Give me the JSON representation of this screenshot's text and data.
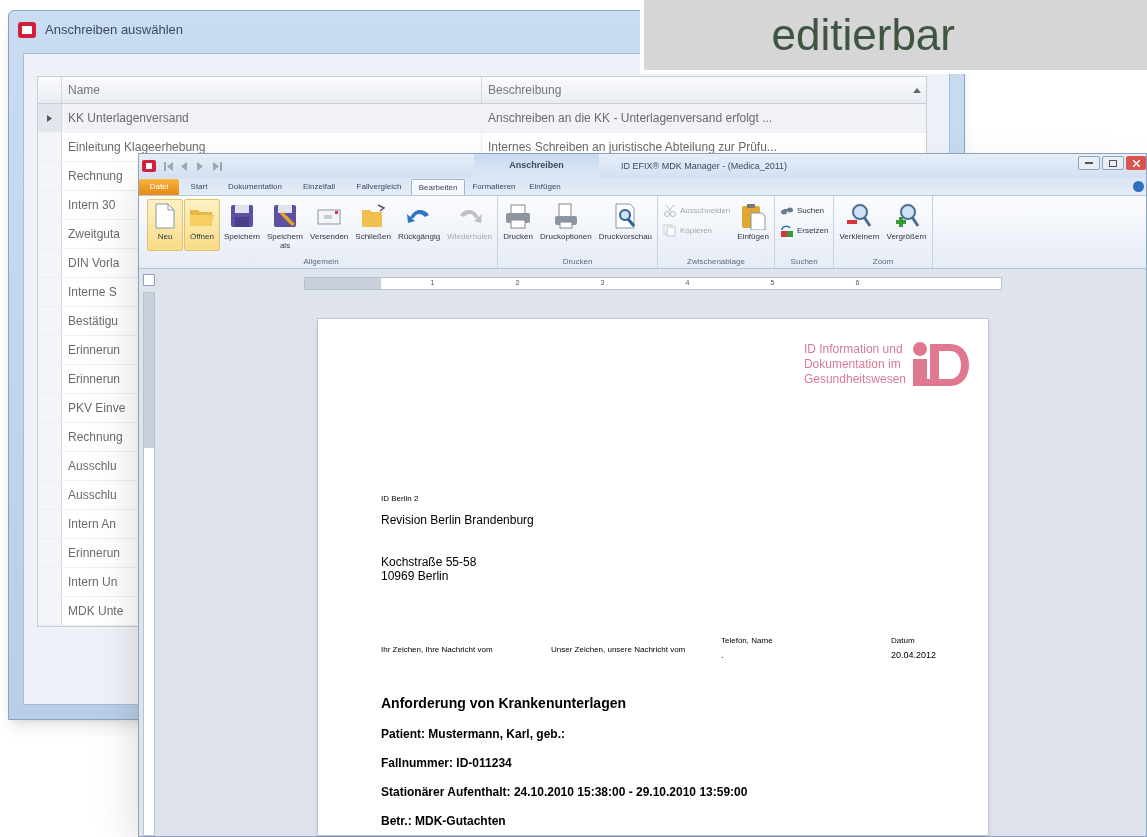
{
  "banner": {
    "text": "editierbar"
  },
  "dialog": {
    "title": "Anschreiben auswählen",
    "columns": [
      "Name",
      "Beschreibung"
    ],
    "rows": [
      {
        "name": "KK Unterlagenversand",
        "description": "Anschreiben an die KK - Unterlagenversand erfolgt ...",
        "selected": true
      },
      {
        "name": "Einleitung Klageerhebung",
        "description": "Internes Schreiben an juristische Abteilung zur Prüfu...",
        "selected": false
      },
      {
        "name": "Rechnung",
        "selected": false
      },
      {
        "name": "Intern 30",
        "selected": false
      },
      {
        "name": "Zweitguta",
        "selected": false
      },
      {
        "name": "DIN Vorla",
        "selected": false
      },
      {
        "name": "Interne S",
        "selected": false
      },
      {
        "name": "Bestätigu",
        "selected": false
      },
      {
        "name": "Erinnerun",
        "selected": false
      },
      {
        "name": "Erinnerun",
        "selected": false
      },
      {
        "name": "PKV Einve",
        "selected": false
      },
      {
        "name": "Rechnung",
        "selected": false
      },
      {
        "name": "Ausschlu",
        "selected": false
      },
      {
        "name": "Ausschlu",
        "selected": false
      },
      {
        "name": "Intern An",
        "selected": false
      },
      {
        "name": "Erinnerun",
        "selected": false
      },
      {
        "name": "Intern Un",
        "selected": false
      },
      {
        "name": "MDK Unte",
        "selected": false
      }
    ]
  },
  "window": {
    "context_tab": "Anschreiben",
    "title": "ID EFIX® MDK Manager - (Medica_2011)",
    "tabs": [
      {
        "label": "Datei",
        "kind": "file",
        "selected": false
      },
      {
        "label": "Start",
        "kind": "tab",
        "selected": false
      },
      {
        "label": "Dokumentation",
        "kind": "tab",
        "selected": false
      },
      {
        "label": "Einzelfall",
        "kind": "tab",
        "selected": false
      },
      {
        "label": "Fallvergleich",
        "kind": "tab",
        "selected": false
      },
      {
        "label": "Bearbeiten",
        "kind": "tab",
        "selected": true
      },
      {
        "label": "Formatieren",
        "kind": "tab",
        "selected": false
      },
      {
        "label": "Einfügen",
        "kind": "tab",
        "selected": false
      }
    ],
    "ribbon": [
      {
        "label": "Allgemein",
        "items": [
          {
            "label": "Neu",
            "kind": "large",
            "highlighted": true,
            "disabled": false
          },
          {
            "label": "Öffnen",
            "kind": "large",
            "highlighted": true,
            "disabled": false
          },
          {
            "label": "Speichern",
            "kind": "large",
            "highlighted": false,
            "disabled": false
          },
          {
            "label": "Speichern als",
            "kind": "large",
            "highlighted": false,
            "disabled": false
          },
          {
            "label": "Versenden",
            "kind": "large",
            "highlighted": false,
            "disabled": false
          },
          {
            "label": "Schließen",
            "kind": "large",
            "highlighted": false,
            "disabled": false
          },
          {
            "label": "Rückgängig",
            "kind": "large",
            "highlighted": false,
            "disabled": false
          },
          {
            "label": "Wiederholen",
            "kind": "large",
            "highlighted": false,
            "disabled": true
          }
        ]
      },
      {
        "label": "Drucken",
        "items": [
          {
            "label": "Drucken",
            "kind": "large",
            "highlighted": false,
            "disabled": false
          },
          {
            "label": "Druckoptionen",
            "kind": "large",
            "highlighted": false,
            "disabled": false
          },
          {
            "label": "Druckvorschau",
            "kind": "large",
            "highlighted": false,
            "disabled": false
          }
        ]
      },
      {
        "label": "Zwischenablage",
        "items": [
          {
            "label": "Ausschneiden",
            "kind": "small",
            "highlighted": false,
            "disabled": true
          },
          {
            "label": "Kopieren",
            "kind": "small",
            "highlighted": false,
            "disabled": true
          },
          {
            "label": "Einfügen",
            "kind": "large",
            "highlighted": false,
            "disabled": false
          }
        ]
      },
      {
        "label": "Suchen",
        "items": [
          {
            "label": "Suchen",
            "kind": "small",
            "highlighted": false,
            "disabled": false
          },
          {
            "label": "Ersetzen",
            "kind": "small",
            "highlighted": false,
            "disabled": false
          }
        ]
      },
      {
        "label": "Zoom",
        "items": [
          {
            "label": "Verkleinern",
            "kind": "large",
            "highlighted": false,
            "disabled": false
          },
          {
            "label": "Vergrößern",
            "kind": "large",
            "highlighted": false,
            "disabled": false
          }
        ]
      }
    ],
    "ruler_marks": [
      "1",
      "2",
      "3",
      "4",
      "5",
      "6"
    ]
  },
  "document": {
    "logo_lines": [
      "ID Information und",
      "Dokumentation im",
      "Gesundheitswesen"
    ],
    "sender": "ID Berlin 2",
    "recipient": "Revision Berlin Brandenburg",
    "street": "Kochstraße 55-58",
    "city": "10969 Berlin",
    "reference_fields": [
      {
        "label": "Ihr Zeichen, Ihre Nachricht vom"
      },
      {
        "label": "Unser Zeichen, unsere Nachricht vom"
      },
      {
        "label": "Telefon, Name",
        "value": "."
      },
      {
        "label": "Datum",
        "value": "20.04.2012"
      }
    ],
    "subject": "Anforderung von Krankenunterlagen",
    "lines": [
      "Patient: Mustermann, Karl, geb.:",
      "Fallnummer: ID-011234",
      "Stationärer Aufenthalt: 24.10.2010 15:38:00 -  29.10.2010 13:59:00",
      "Betr.: MDK-Gutachten"
    ]
  }
}
